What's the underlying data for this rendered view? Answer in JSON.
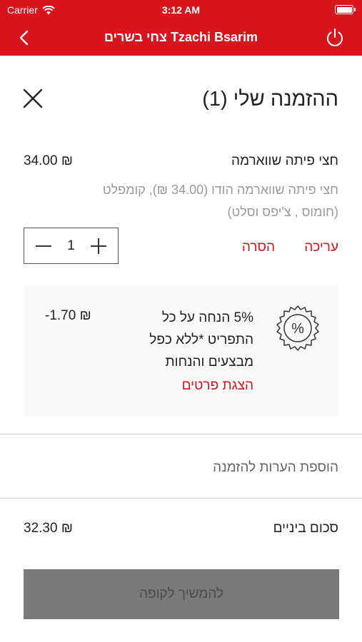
{
  "status_bar": {
    "carrier": "Carrier",
    "time": "3:12 AM"
  },
  "nav": {
    "title": "צחי בשרים Tzachi Bsarim",
    "back_icon": "chevron-left-icon",
    "power_icon": "power-icon"
  },
  "order": {
    "title": "ההזמנה שלי (1)",
    "close_icon": "close-icon"
  },
  "item": {
    "name": "חצי פיתה שווארמה",
    "price": "34.00 ₪",
    "description": "חצי פיתה שווארמה הודו (34.00 ₪), קומפלט (חומוס , צ'יפס וסלט)",
    "quantity": "1",
    "edit_label": "עריכה",
    "remove_label": "הסרה"
  },
  "discount": {
    "text": "5% הנחה על כל התפריט *ללא כפל מבצעים והנחות",
    "details_label": "הצגת פרטים",
    "amount": "-1.70 ₪",
    "icon": "percent-badge-icon"
  },
  "notes": {
    "label": "הוספת הערות להזמנה"
  },
  "summary": {
    "subtotal_label": "סכום ביניים",
    "subtotal_value": "32.30 ₪"
  },
  "checkout": {
    "label": "להמשיך לקופה"
  },
  "colors": {
    "brand_red": "#d8141c",
    "button_gray": "#7a7a7a"
  }
}
